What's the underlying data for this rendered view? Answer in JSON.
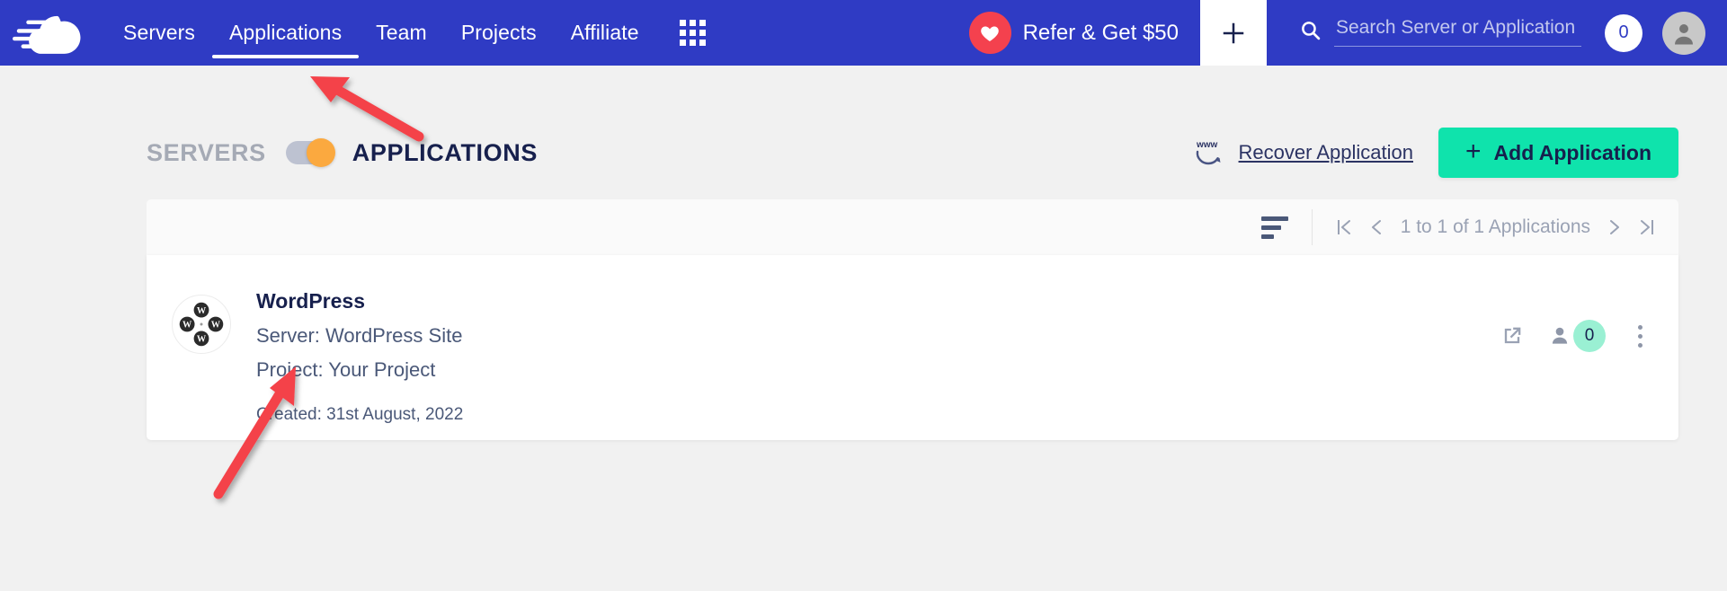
{
  "navbar": {
    "logo_name": "cloudways-logo",
    "links": [
      {
        "label": "Servers",
        "active": false
      },
      {
        "label": "Applications",
        "active": true
      },
      {
        "label": "Team",
        "active": false
      },
      {
        "label": "Projects",
        "active": false
      },
      {
        "label": "Affiliate",
        "active": false
      }
    ],
    "grid_icon": "apps-grid-icon",
    "refer": {
      "label": "Refer & Get $50",
      "icon": "heart-icon",
      "badge_color": "#f4414e"
    },
    "add_button_icon": "plus-icon",
    "search": {
      "placeholder": "Search Server or Application",
      "value": "",
      "icon": "search-icon"
    },
    "notification_count": "0",
    "avatar_icon": "user-avatar-icon",
    "background_color": "#2f3bc4"
  },
  "page_header": {
    "segment_left": "SERVERS",
    "segment_right": "APPLICATIONS",
    "toggle_state": "applications",
    "toggle_knob_color": "#fba93f",
    "recover_link": "Recover Application",
    "recover_icon": "www-recover-icon",
    "add_application_button": "Add Application",
    "add_application_color": "#0fe3ac"
  },
  "toolbar": {
    "sort_icon": "sort-filter-icon",
    "pagination": {
      "first_icon": "first-page-icon",
      "prev_icon": "previous-page-icon",
      "text": "1 to 1 of 1 Applications",
      "next_icon": "next-page-icon",
      "last_icon": "last-page-icon"
    }
  },
  "application_card": {
    "icon": "wordpress-multisite-icon",
    "title": "WordPress",
    "server_label": "Server: WordPress Site",
    "project_label": "Project: Your Project",
    "created_label": "Created: 31st August, 2022",
    "actions": {
      "launch_icon": "external-link-icon",
      "users_icon": "user-icon",
      "users_count": "0",
      "users_count_color": "#9af0d3",
      "menu_icon": "kebab-menu-icon"
    }
  },
  "annotations": {
    "arrow_color": "#f4424a",
    "arrow_1_target": "applications-nav-tab",
    "arrow_2_target": "project-label"
  }
}
